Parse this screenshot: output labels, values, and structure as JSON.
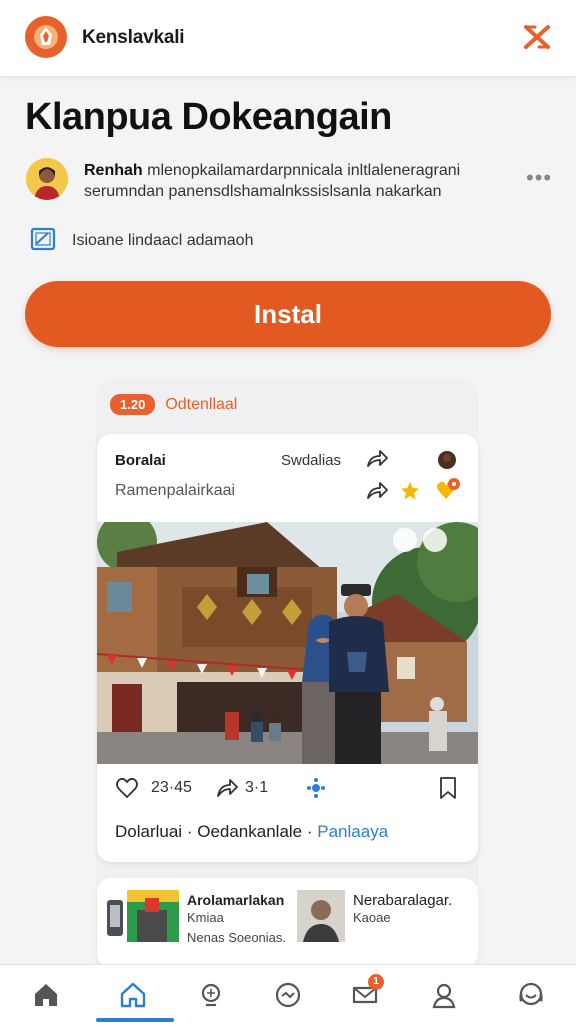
{
  "header": {
    "app_name": "Kenslavkali"
  },
  "page": {
    "title": "Klanpua Dokeangain",
    "description_author": "Renhah",
    "description_line1_rest": " mlenopkailamardarpnnicala inltlaleneragrani",
    "description_line2": "serumndan panensdlshamalnkssislsanla nakarkan",
    "tag_text": "Isioane lindaacl adamaoh",
    "install_label": "Instal"
  },
  "promo": {
    "badge": "1.20",
    "label": "Odtenllaal"
  },
  "post": {
    "header_left": "Boralai",
    "header_right": "Swdalias",
    "subheader": "Ramenpalairkaai",
    "likes": "23·45",
    "shares": "3·1",
    "tag1": "Dolarluai",
    "tag2": "Oedankanlale",
    "tag3": "Panlaaya"
  },
  "mini_cards": [
    {
      "title": "Arolamarlakan",
      "sub1": "Kmiaa",
      "sub2": "Nenas Soeonias."
    },
    {
      "title": "Nerabaralagar.",
      "sub1": "Kaoae"
    }
  ],
  "nav": {
    "items": [
      "home-icon",
      "home-active-icon",
      "search-icon",
      "chat-icon",
      "notifications-icon",
      "profile-icon",
      "support-icon"
    ],
    "notification_count": "1"
  },
  "colors": {
    "accent": "#e25a22",
    "link": "#2a7fd4",
    "background": "#f4f4f5"
  }
}
